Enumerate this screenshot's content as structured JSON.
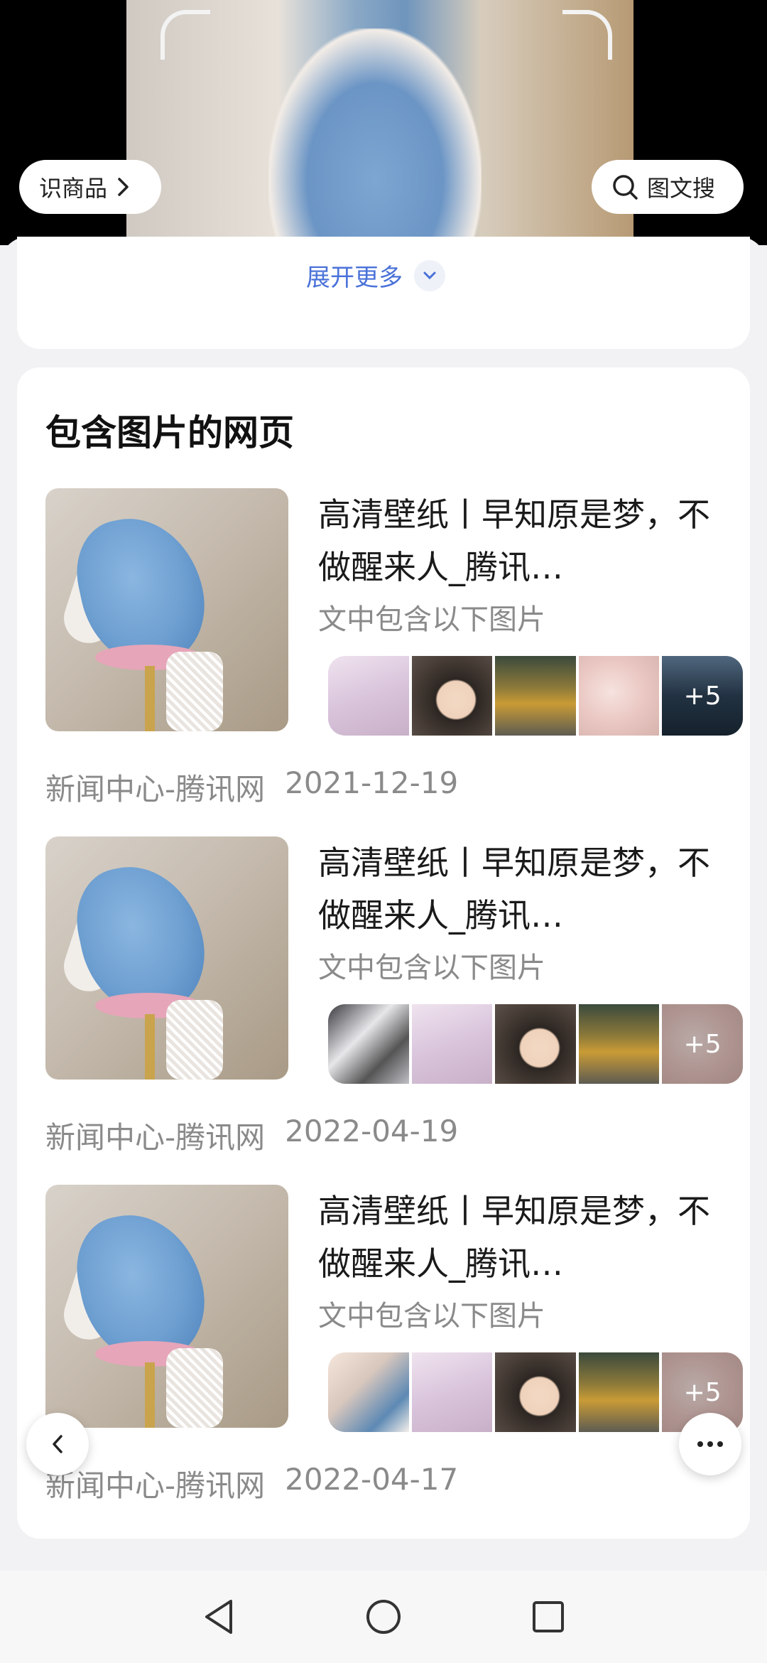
{
  "preview": {
    "product_button": "识商品",
    "search_button": "图文搜"
  },
  "top_card": {
    "expand_label": "展开更多"
  },
  "section": {
    "title": "包含图片的网页"
  },
  "results": [
    {
      "title": "高清壁纸丨早知原是梦，不做醒来人_腾讯…",
      "subtitle": "文中包含以下图片",
      "more_count": "+5",
      "source": "新闻中心-腾讯网",
      "date": "2021-12-19"
    },
    {
      "title": "高清壁纸丨早知原是梦，不做醒来人_腾讯…",
      "subtitle": "文中包含以下图片",
      "more_count": "+5",
      "source": "新闻中心-腾讯网",
      "date": "2022-04-19"
    },
    {
      "title": "高清壁纸丨早知原是梦，不做醒来人_腾讯…",
      "subtitle": "文中包含以下图片",
      "more_count": "+5",
      "source": "新闻中心-腾讯网",
      "date": "2022-04-17"
    }
  ],
  "icons": {
    "product_chevron": "chevron-right-icon",
    "search": "search-icon",
    "expand": "chevron-down-icon",
    "back": "chevron-left-icon",
    "more": "more-dots-icon",
    "nav_back": "triangle-back-icon",
    "nav_home": "circle-home-icon",
    "nav_recent": "square-recent-icon"
  },
  "colors": {
    "link": "#4a72d8",
    "muted_text": "#8a8a8a",
    "sheet_bg": "#f2f2f4"
  }
}
